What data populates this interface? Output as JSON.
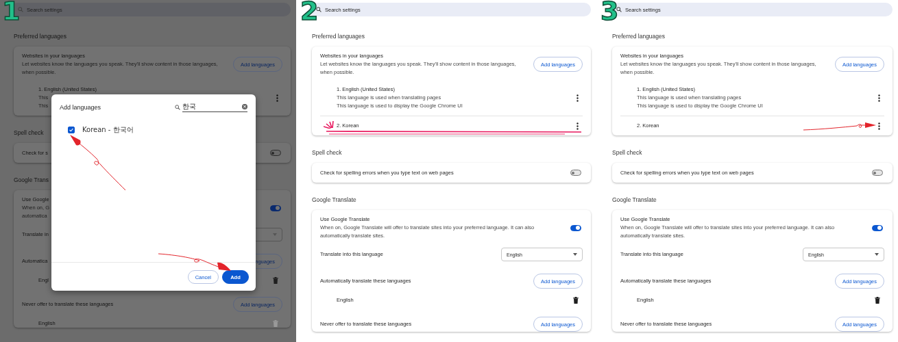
{
  "panels": [
    {
      "step": "1",
      "dimmed": true,
      "search": {
        "placeholder": "Search settings"
      },
      "sections": [
        {
          "heading": "Preferred languages",
          "rows": [
            {
              "kind": "intro",
              "title": "Websites in your languages",
              "lines": [
                "Let websites know the languages you speak. They'll show content in those languages,",
                "when possible."
              ],
              "button": "Add languages"
            },
            {
              "kind": "language",
              "name": "1. English (United States)",
              "notes": [
                "This",
                "This"
              ]
            }
          ]
        },
        {
          "heading": "Spell check",
          "rows": [
            {
              "kind": "check",
              "text": "Check for s",
              "toggle": {
                "on": false
              }
            }
          ]
        },
        {
          "heading": "Google Trans",
          "rows": [
            {
              "kind": "intro",
              "title": "Use Google",
              "lines": [
                "When on, G",
                "automatica"
              ],
              "toggle": {
                "on": true
              }
            },
            {
              "kind": "select",
              "label": "Translate in"
            },
            {
              "kind": "list-header",
              "label": "Automatica",
              "button": "nguages"
            },
            {
              "kind": "entry",
              "text": "Engl",
              "disabled": false
            },
            {
              "kind": "list-header",
              "label": "Never offer to translate these languages",
              "button": "Add languages"
            },
            {
              "kind": "entry",
              "text": "English",
              "disabled": true
            }
          ]
        }
      ],
      "dialog": {
        "title": "Add languages",
        "search": {
          "value": "한국"
        },
        "items": [
          {
            "label": "Korean - 한국어",
            "checked": true,
            "arrow": true
          }
        ],
        "buttons": [
          {
            "label": "Cancel",
            "kind": "secondary"
          },
          {
            "label": "Add",
            "kind": "primary",
            "arrow": true
          }
        ]
      }
    },
    {
      "step": "2",
      "dimmed": false,
      "search": {
        "placeholder": "Search settings"
      },
      "sections": [
        {
          "heading": "Preferred languages",
          "rows": [
            {
              "kind": "intro",
              "title": "Websites in your languages",
              "lines": [
                "Let websites know the languages you speak. They'll show content in those languages,",
                "when possible."
              ],
              "button": "Add languages"
            },
            {
              "kind": "language",
              "name": "1. English (United States)",
              "notes": [
                "This language is used when translating pages",
                "This language is used to display the Google Chrome UI"
              ]
            },
            {
              "kind": "language",
              "name": "2. Korean",
              "underline": true
            }
          ]
        },
        {
          "heading": "Spell check",
          "rows": [
            {
              "kind": "check",
              "text": "Check for spelling errors when you type text on web pages",
              "toggle": {
                "on": false
              }
            }
          ]
        },
        {
          "heading": "Google Translate",
          "rows": [
            {
              "kind": "intro",
              "title": "Use Google Translate",
              "lines": [
                "When on, Google Translate will offer to translate sites into your preferred language. It can also",
                "automatically translate sites."
              ],
              "toggle": {
                "on": true
              }
            },
            {
              "kind": "select",
              "label": "Translate into this language",
              "value": "English"
            },
            {
              "kind": "list-header",
              "label": "Automatically translate these languages",
              "button": "Add languages"
            },
            {
              "kind": "entry",
              "text": "English",
              "disabled": false
            },
            {
              "kind": "list-header",
              "label": "Never offer to translate these languages",
              "button": "Add languages"
            }
          ]
        }
      ]
    },
    {
      "step": "3",
      "dimmed": false,
      "search": {
        "placeholder": "Search settings"
      },
      "sections": [
        {
          "heading": "Preferred languages",
          "rows": [
            {
              "kind": "intro",
              "title": "Websites in your languages",
              "lines": [
                "Let websites know the languages you speak. They'll show content in those languages,",
                "when possible."
              ],
              "button": "Add languages"
            },
            {
              "kind": "language",
              "name": "1. English (United States)",
              "notes": [
                "This language is used when translating pages",
                "This language is used to display the Google Chrome UI"
              ]
            },
            {
              "kind": "language",
              "name": "2. Korean",
              "arrow": true
            }
          ]
        },
        {
          "heading": "Spell check",
          "rows": [
            {
              "kind": "check",
              "text": "Check for spelling errors when you type text on web pages",
              "toggle": {
                "on": false
              }
            }
          ]
        },
        {
          "heading": "Google Translate",
          "rows": [
            {
              "kind": "intro",
              "title": "Use Google Translate",
              "lines": [
                "When on, Google Translate will offer to translate sites into your preferred language. It can also",
                "automatically translate sites."
              ],
              "toggle": {
                "on": true
              }
            },
            {
              "kind": "select",
              "label": "Translate into this language",
              "value": "English"
            },
            {
              "kind": "list-header",
              "label": "Automatically translate these languages",
              "button": "Add languages"
            },
            {
              "kind": "entry",
              "text": "English",
              "disabled": false
            },
            {
              "kind": "list-header",
              "label": "Never offer to translate these languages",
              "button": "Add languages"
            }
          ]
        }
      ]
    }
  ]
}
